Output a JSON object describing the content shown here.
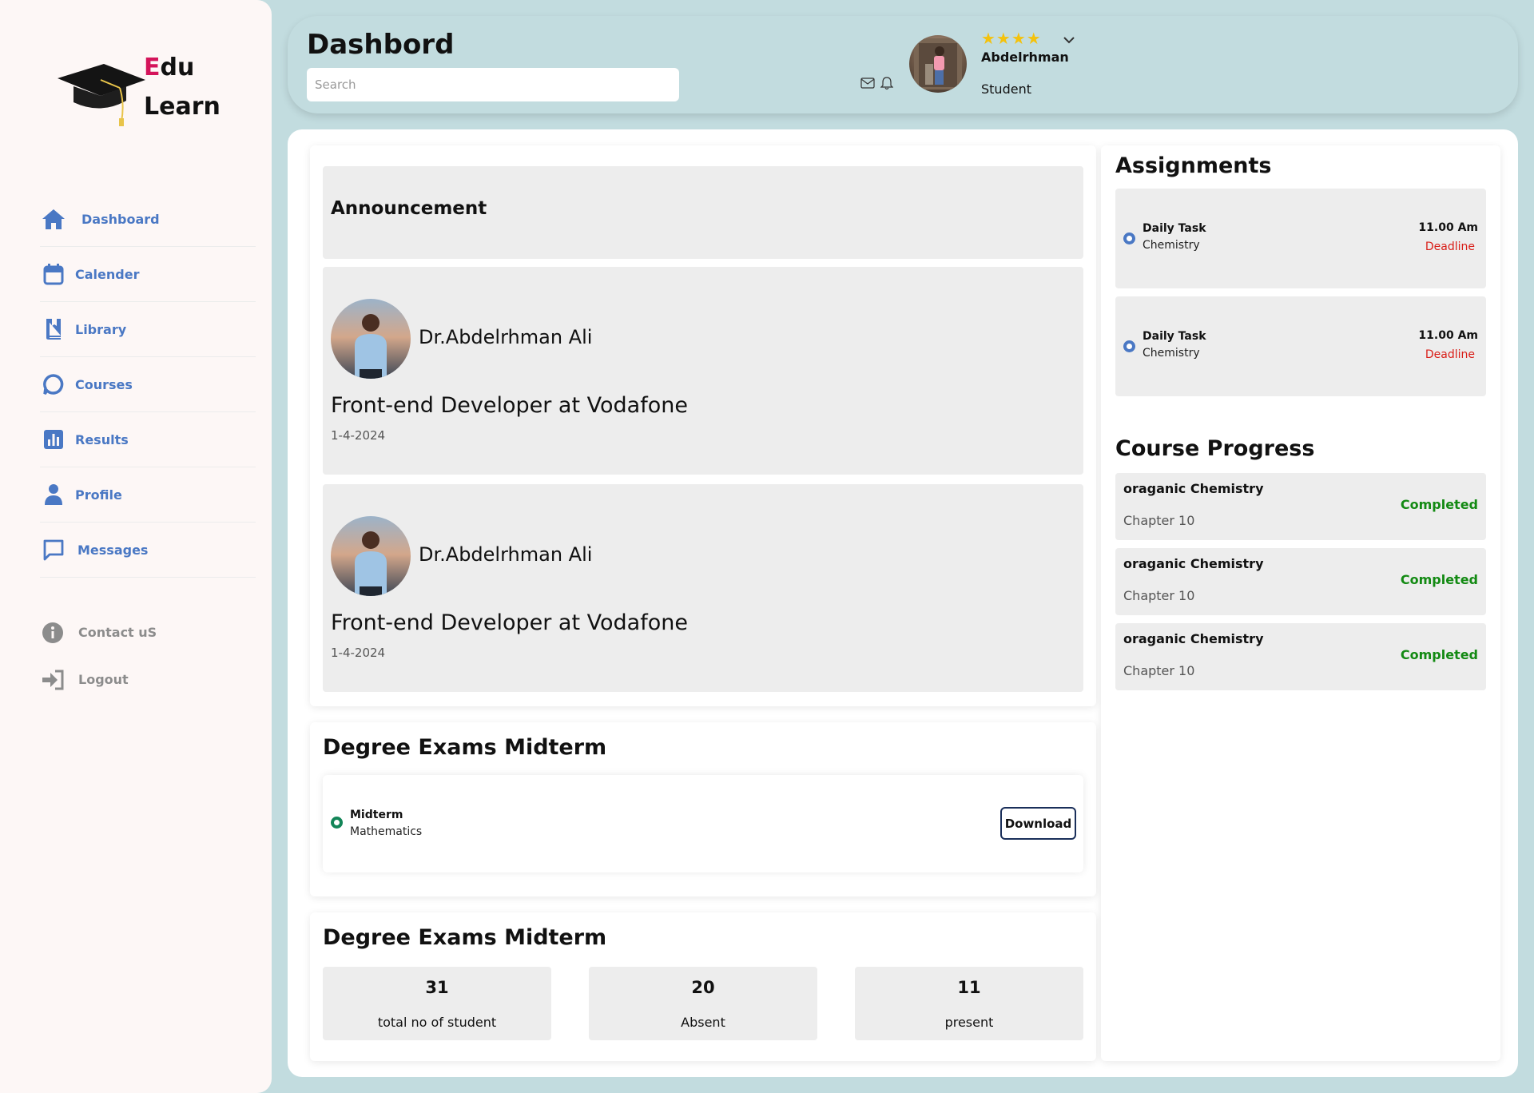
{
  "app": {
    "logo_first_letter": "E",
    "logo_rest_top": "du",
    "logo_bottom": "Learn"
  },
  "sidebar": {
    "items": [
      {
        "label": "Dashboard",
        "icon": "home-icon"
      },
      {
        "label": "Calender",
        "icon": "calendar-icon"
      },
      {
        "label": "Library",
        "icon": "book-icon"
      },
      {
        "label": "Courses",
        "icon": "chat-bubble-icon"
      },
      {
        "label": "Results",
        "icon": "bar-chart-icon"
      },
      {
        "label": "Profile",
        "icon": "user-icon"
      },
      {
        "label": "Messages",
        "icon": "message-icon"
      }
    ],
    "secondary": [
      {
        "label": "Contact uS",
        "icon": "info-icon"
      },
      {
        "label": "Logout",
        "icon": "logout-icon"
      }
    ]
  },
  "header": {
    "title": "Dashbord",
    "search_placeholder": "Search",
    "user_name": "Abdelrhman",
    "user_role": "Student",
    "rating_stars": "★★★★",
    "rating": 4
  },
  "announcements": {
    "title": "Announcement",
    "posts": [
      {
        "author": "Dr.Abdelrhman Ali",
        "role": "Front-end Developer at Vodafone",
        "date": "1-4-2024"
      },
      {
        "author": "Dr.Abdelrhman Ali",
        "role": "Front-end Developer at Vodafone",
        "date": "1-4-2024"
      }
    ]
  },
  "midterm": {
    "title": "Degree Exams Midterm",
    "exam_name": "Midterm",
    "subject": "Mathematics",
    "download_label": "Download"
  },
  "stats": {
    "title": "Degree Exams Midterm",
    "items": [
      {
        "value": "31",
        "label": "total no of student"
      },
      {
        "value": "20",
        "label": "Absent"
      },
      {
        "value": "11",
        "label": "present"
      }
    ]
  },
  "assignments": {
    "title": "Assignments",
    "items": [
      {
        "name": "Daily Task",
        "subject": "Chemistry",
        "time": "11.00 Am",
        "status": "Deadline"
      },
      {
        "name": "Daily Task",
        "subject": "Chemistry",
        "time": "11.00 Am",
        "status": "Deadline"
      }
    ]
  },
  "progress": {
    "title": "Course Progress",
    "items": [
      {
        "course": "oraganic Chemistry",
        "chapter": "Chapter 10",
        "status": "Completed"
      },
      {
        "course": "oraganic Chemistry",
        "chapter": "Chapter 10",
        "status": "Completed"
      },
      {
        "course": "oraganic Chemistry",
        "chapter": "Chapter 10",
        "status": "Completed"
      }
    ]
  },
  "colors": {
    "accent": "#4a78c4",
    "brand_red": "#d4145a",
    "background": "#c2dcdf",
    "completed": "#138a13",
    "deadline": "#d91e18"
  }
}
